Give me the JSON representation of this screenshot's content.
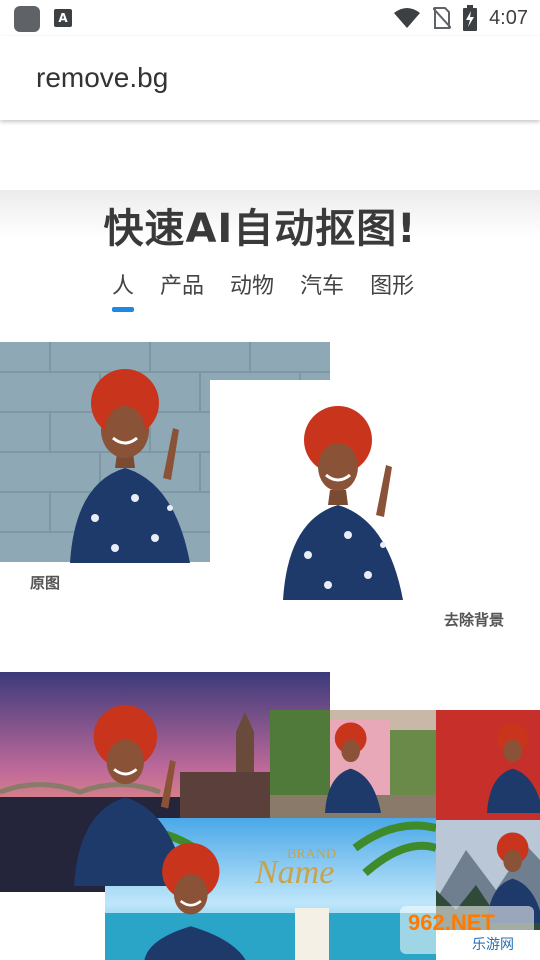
{
  "status_bar": {
    "time": "4:07",
    "icons": [
      "app-icon",
      "a-icon",
      "wifi-icon",
      "no-sim-icon",
      "battery-charging-icon"
    ]
  },
  "app_bar": {
    "title": "remove.bg"
  },
  "hero": {
    "headline": "快速AI自动抠图!",
    "tabs": [
      {
        "label": "人",
        "active": true
      },
      {
        "label": "产品",
        "active": false
      },
      {
        "label": "动物",
        "active": false
      },
      {
        "label": "汽车",
        "active": false
      },
      {
        "label": "图形",
        "active": false
      }
    ]
  },
  "demo": {
    "original_label": "原图",
    "removed_label": "去除背景"
  },
  "backgrounds": {
    "brand_text": "BRAND",
    "name_text": "Name"
  },
  "watermark": {
    "top": "962.NET",
    "bottom": "乐游网"
  },
  "colors": {
    "accent": "#1e88e5",
    "hair": "#c8341c",
    "dress": "#1d3a6b"
  }
}
